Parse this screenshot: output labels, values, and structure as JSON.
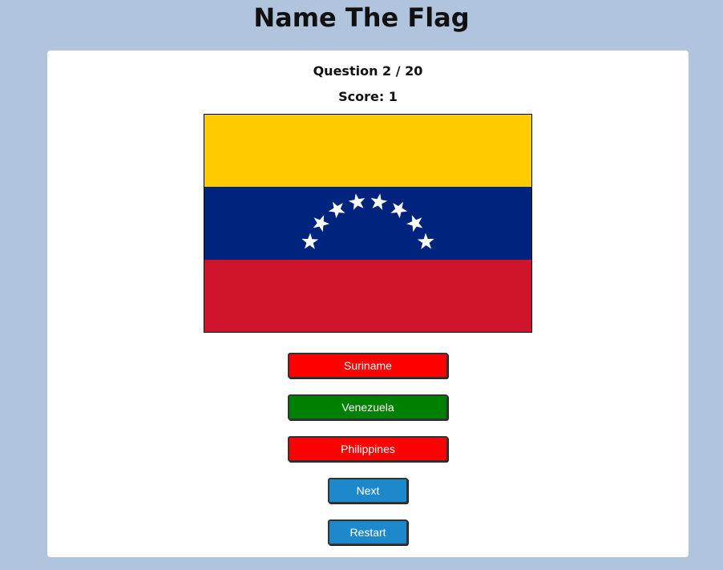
{
  "page": {
    "title": "Name The Flag"
  },
  "quiz": {
    "question_label": "Question 2 / 20",
    "score_label": "Score: 1",
    "flag": {
      "icon": "flag-of-venezuela",
      "stripe_colors": [
        "#ffcc00",
        "#00247d",
        "#cf142b"
      ],
      "star_color": "#ffffff",
      "star_count": 8
    },
    "answers": [
      {
        "label": "Suriname",
        "state": "incorrect",
        "color": "#ff0000"
      },
      {
        "label": "Venezuela",
        "state": "correct",
        "color": "#008000"
      },
      {
        "label": "Philippines",
        "state": "incorrect",
        "color": "#ff0000"
      }
    ],
    "controls": {
      "next_label": "Next",
      "restart_label": "Restart",
      "color": "#1e88cc"
    }
  },
  "colors": {
    "page_background": "#b0c4de",
    "card_background": "#ffffff"
  }
}
